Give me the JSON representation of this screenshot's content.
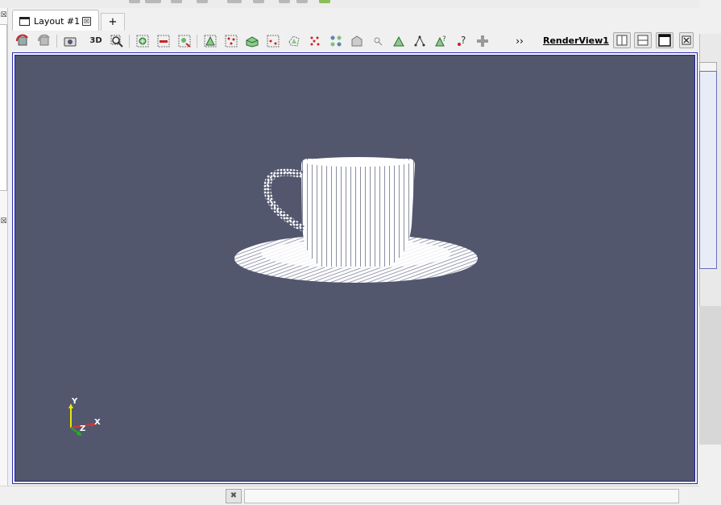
{
  "layout_tab": {
    "label": "Layout #1",
    "close_glyph": "☒"
  },
  "add_tab_label": "+",
  "toolbar": {
    "three_d_label": "3D",
    "more_label": "››",
    "render_view_name": "RenderView1",
    "buttons": [
      "reset-camera-icon",
      "reset-camera-closest-icon",
      "capture-screenshot-icon",
      "3d-toggle",
      "zoom-to-box-icon",
      "select-cells-on-icon",
      "select-points-on-icon",
      "zoom-to-data-icon",
      "select-cells-through-icon",
      "select-points-through-icon",
      "select-cells-polygon-icon",
      "select-points-polygon-icon",
      "select-blocks-icon",
      "interactive-select-cells-icon",
      "interactive-select-points-icon",
      "hover-points-icon",
      "hover-cells-icon",
      "grow-selection-icon",
      "shrink-selection-icon",
      "clear-selection-icon",
      "find-data-icon",
      "more-icon"
    ],
    "layout_buttons": [
      "split-horizontal-icon",
      "split-vertical-icon",
      "maximize-icon",
      "close-view-icon"
    ]
  },
  "axes": {
    "y": "Y",
    "x": "X",
    "z": "Z"
  },
  "colors": {
    "render_background": "#52576e",
    "view_border": "#2020a0",
    "axis_y": "#e8e800",
    "axis_x": "#e03030",
    "axis_z": "#20b020"
  },
  "scene": {
    "object": "teacup-point-cloud",
    "point_color": "#ffffff"
  },
  "status": {
    "stop_glyph": "✖",
    "message": ""
  }
}
